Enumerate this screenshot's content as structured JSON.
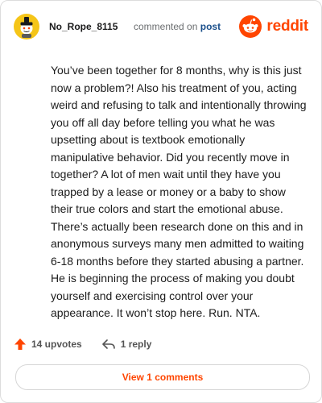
{
  "comment": {
    "author": "No_Rope_8115",
    "meta_prefix": "commented on",
    "meta_link": "post",
    "body": "You’ve been together for 8 months, why is this just now a problem?! Also his treatment of you, acting weird and refusing to talk and intentionally throwing you off all day before telling you what he was upsetting about is textbook emotionally manipulative behavior. Did you recently move in together? A lot of men wait until they have you trapped by a lease or money or a baby to show their true colors and start the emotional abuse. There’s actually been research done on this and in anonymous surveys many men admitted to waiting 6-18 months before they started abusing a partner. He is beginning the process of making you doubt yourself and exercising control over your appearance. It won’t stop here. Run. NTA."
  },
  "brand": {
    "name": "reddit",
    "color": "#ff4500"
  },
  "actions": {
    "upvotes_label": "14 upvotes",
    "reply_label": "1 reply"
  },
  "footer": {
    "view_comments_label": "View 1 comments"
  },
  "icons": {
    "avatar": "snoo-avatar-icon",
    "brand": "reddit-logo-icon",
    "upvote": "upvote-arrow-icon",
    "reply": "reply-arrow-icon"
  },
  "colors": {
    "accent": "#ff4500",
    "avatar_bg": "#f5c518",
    "link": "#1a4f8b"
  }
}
